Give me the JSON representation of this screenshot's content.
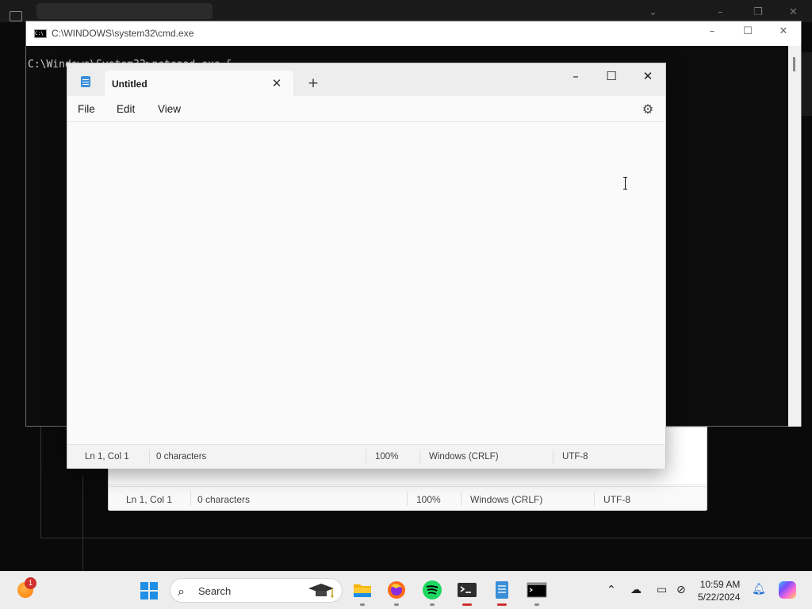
{
  "cmd": {
    "title": "C:\\WINDOWS\\system32\\cmd.exe",
    "line": "C:\\Windows\\System32>notepad.exe &"
  },
  "notepad": {
    "tab_title": "Untitled",
    "menus": [
      "File",
      "Edit",
      "View"
    ],
    "status": {
      "position": "Ln 1, Col 1",
      "characters": "0 characters",
      "zoom": "100%",
      "line_ending": "Windows (CRLF)",
      "encoding": "UTF-8"
    }
  },
  "ghost_notepad": {
    "status": {
      "position": "Ln 1, Col 1",
      "characters": "0 characters",
      "zoom": "100%",
      "line_ending": "Windows (CRLF)",
      "encoding": "UTF-8"
    }
  },
  "taskbar": {
    "widget_badge": "1",
    "search_label": "Search",
    "apps": [
      "file-explorer",
      "firefox",
      "spotify",
      "terminal",
      "notepad",
      "cmd"
    ],
    "clock_time": "10:59 AM",
    "clock_date": "5/22/2024"
  },
  "colors": {
    "accent": "#1f8fe6",
    "notification_badge": "#d0312d"
  }
}
